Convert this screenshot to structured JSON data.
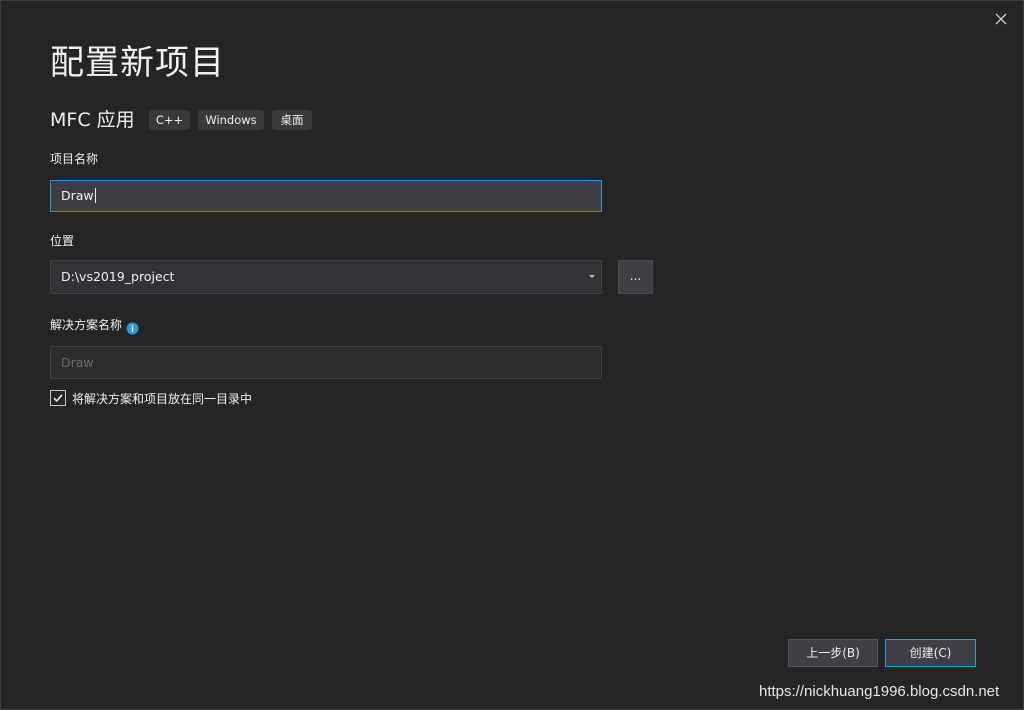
{
  "dialog": {
    "title": "配置新项目",
    "close_icon": "close-icon"
  },
  "project_type": {
    "name": "MFC 应用",
    "tags": [
      "C++",
      "Windows",
      "桌面"
    ]
  },
  "fields": {
    "project_name": {
      "label": "项目名称",
      "value": "Draw"
    },
    "location": {
      "label": "位置",
      "value": "D:\\vs2019_project",
      "browse_label": "...",
      "dropdown_icon": "chevron-down-icon"
    },
    "solution_name": {
      "label": "解决方案名称",
      "info_icon": "info-icon",
      "placeholder": "Draw"
    },
    "same_directory": {
      "label": "将解决方案和项目放在同一目录中",
      "checked": true
    }
  },
  "buttons": {
    "back": "上一步(B)",
    "create": "创建(C)"
  },
  "watermark": "https://nickhuang1996.blog.csdn.net",
  "colors": {
    "background": "#252526",
    "accent": "#3794d4",
    "info": "#3794d4",
    "text": "#f1f1f1"
  }
}
